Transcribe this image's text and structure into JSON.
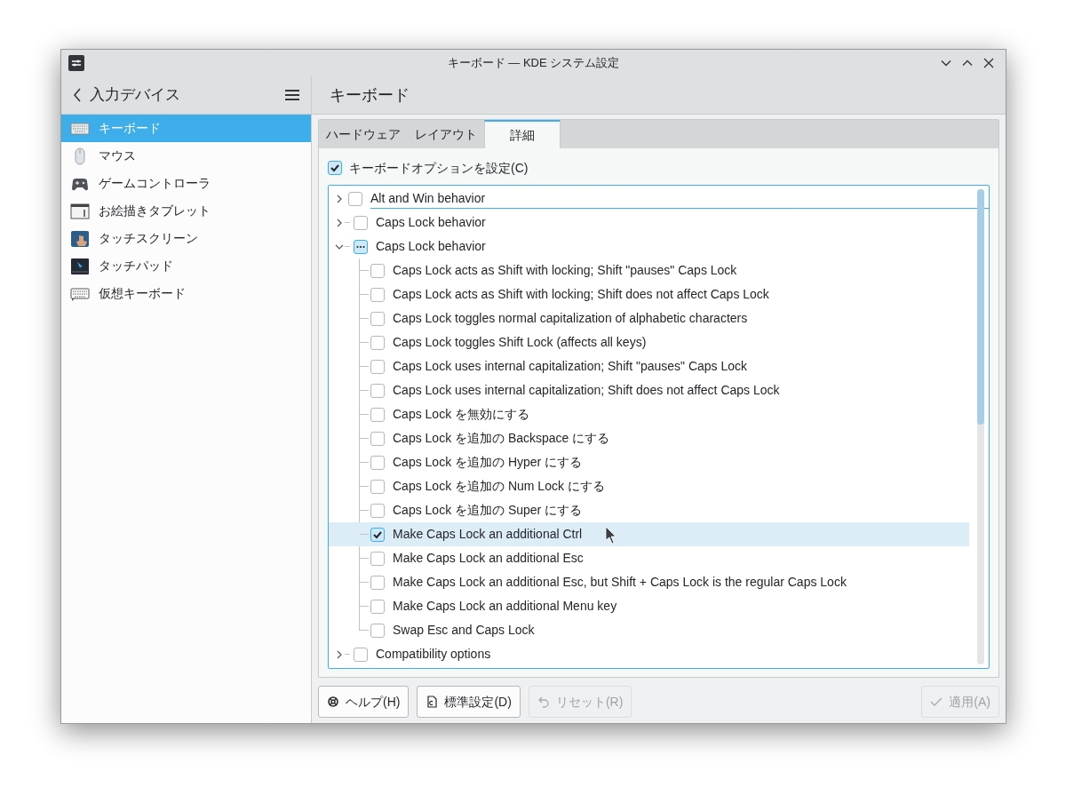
{
  "window": {
    "title": "キーボード — KDE システム設定"
  },
  "sidebar": {
    "title": "入力デバイス",
    "items": [
      {
        "label": "キーボード",
        "kind": "keyboard",
        "selected": true
      },
      {
        "label": "マウス",
        "kind": "mouse",
        "selected": false
      },
      {
        "label": "ゲームコントローラ",
        "kind": "gamepad",
        "selected": false
      },
      {
        "label": "お絵描きタブレット",
        "kind": "tablet",
        "selected": false
      },
      {
        "label": "タッチスクリーン",
        "kind": "touchscreen",
        "selected": false
      },
      {
        "label": "タッチパッド",
        "kind": "touchpad",
        "selected": false
      },
      {
        "label": "仮想キーボード",
        "kind": "virtualkeyboard",
        "selected": false
      }
    ]
  },
  "page": {
    "title": "キーボード"
  },
  "tabs": [
    {
      "label": "ハードウェア",
      "selected": false
    },
    {
      "label": "レイアウト",
      "selected": false
    },
    {
      "label": "詳細",
      "selected": true
    }
  ],
  "configure_option": {
    "label": "キーボードオプションを設定(C)",
    "checked": true
  },
  "tree": [
    {
      "label": "Alt and Win behavior",
      "checked": false,
      "partial": false,
      "expanded": false,
      "focused": true
    },
    {
      "label": "Caps Lock behavior",
      "checked": false,
      "partial": false,
      "expanded": false,
      "focused": false
    },
    {
      "label": "Caps Lock behavior",
      "checked": false,
      "partial": true,
      "expanded": true,
      "focused": false,
      "children": [
        {
          "label": "Caps Lock acts as Shift with locking; Shift \"pauses\" Caps Lock",
          "checked": false,
          "selected": false
        },
        {
          "label": "Caps Lock acts as Shift with locking; Shift does not affect Caps Lock",
          "checked": false,
          "selected": false
        },
        {
          "label": "Caps Lock toggles normal capitalization of alphabetic characters",
          "checked": false,
          "selected": false
        },
        {
          "label": "Caps Lock toggles Shift Lock (affects all keys)",
          "checked": false,
          "selected": false
        },
        {
          "label": "Caps Lock uses internal capitalization; Shift \"pauses\" Caps Lock",
          "checked": false,
          "selected": false
        },
        {
          "label": "Caps Lock uses internal capitalization; Shift does not affect Caps Lock",
          "checked": false,
          "selected": false
        },
        {
          "label": "Caps Lock を無効にする",
          "checked": false,
          "selected": false
        },
        {
          "label": "Caps Lock を追加の Backspace にする",
          "checked": false,
          "selected": false
        },
        {
          "label": "Caps Lock を追加の Hyper にする",
          "checked": false,
          "selected": false
        },
        {
          "label": "Caps Lock を追加の Num Lock にする",
          "checked": false,
          "selected": false
        },
        {
          "label": "Caps Lock を追加の Super にする",
          "checked": false,
          "selected": false
        },
        {
          "label": "Make Caps Lock an additional Ctrl",
          "checked": true,
          "selected": true
        },
        {
          "label": "Make Caps Lock an additional Esc",
          "checked": false,
          "selected": false
        },
        {
          "label": "Make Caps Lock an additional Esc, but Shift + Caps Lock is the regular Caps Lock",
          "checked": false,
          "selected": false
        },
        {
          "label": "Make Caps Lock an additional Menu key",
          "checked": false,
          "selected": false
        },
        {
          "label": "Swap Esc and Caps Lock",
          "checked": false,
          "selected": false
        }
      ]
    },
    {
      "label": "Compatibility options",
      "checked": false,
      "partial": false,
      "expanded": false,
      "focused": false
    }
  ],
  "buttons": [
    {
      "label": "ヘルプ(H)",
      "kind": "help",
      "disabled": false
    },
    {
      "label": "標準設定(D)",
      "kind": "defaults",
      "disabled": false
    },
    {
      "label": "リセット(R)",
      "kind": "reset",
      "disabled": true
    },
    {
      "label": "適用(A)",
      "kind": "apply",
      "disabled": true
    }
  ]
}
